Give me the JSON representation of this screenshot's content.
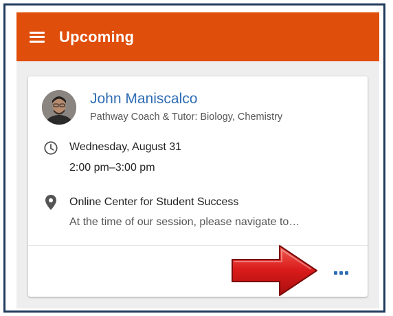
{
  "appbar": {
    "title": "Upcoming",
    "color": "#e04e0b",
    "menu_icon": "hamburger-menu-icon"
  },
  "appointment": {
    "person_name": "John Maniscalco",
    "person_role": "Pathway Coach & Tutor: Biology, Chemistry",
    "date": "Wednesday, August 31",
    "time": "2:00 pm–3:00 pm",
    "location": "Online Center for Student Success",
    "location_detail": "At the time of our session, please navigate to…",
    "more_icon": "more-options-icon",
    "link_color": "#2e6db5"
  },
  "annotation": {
    "arrow_color": "#d91a1a"
  }
}
